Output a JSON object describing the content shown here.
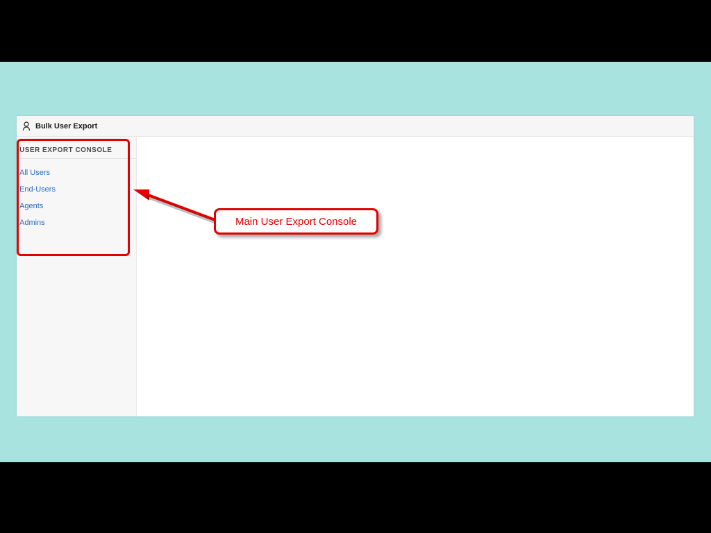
{
  "header": {
    "title": "Bulk User Export",
    "icon": "user-icon"
  },
  "sidebar": {
    "heading": "USER EXPORT CONSOLE",
    "items": [
      {
        "label": "All Users"
      },
      {
        "label": "End-Users"
      },
      {
        "label": "Agents"
      },
      {
        "label": "Admins"
      }
    ]
  },
  "annotation": {
    "callout_label": "Main User Export Console"
  },
  "colors": {
    "stage_bg": "#a8e3e0",
    "link": "#2a6cbf",
    "annotation_red": "#e30000"
  }
}
